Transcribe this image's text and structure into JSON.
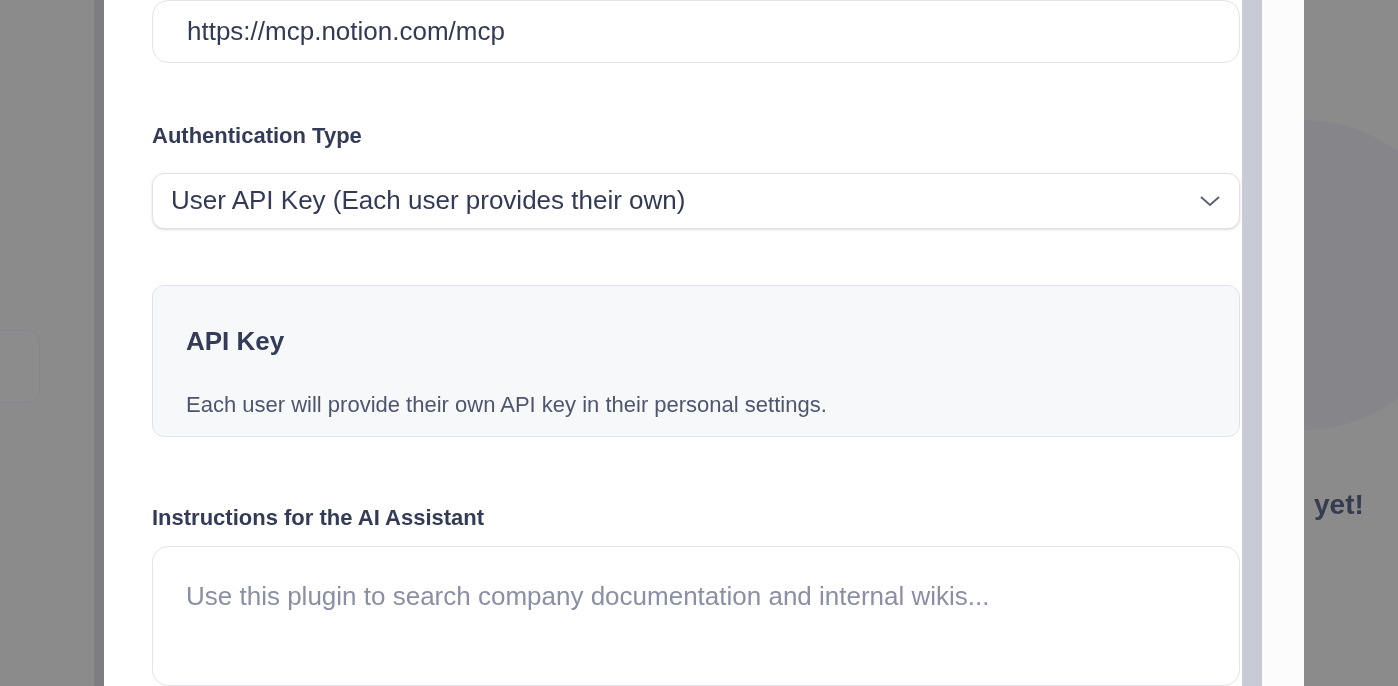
{
  "background": {
    "empty_state_text": "yet!"
  },
  "modal": {
    "server_url": {
      "value": "https://mcp.notion.com/mcp"
    },
    "authentication": {
      "label": "Authentication Type",
      "value": "User API Key (Each user provides their own)"
    },
    "api_key_panel": {
      "title": "API Key",
      "description": "Each user will provide their own API key in their personal settings."
    },
    "instructions": {
      "label": "Instructions for the AI Assistant",
      "placeholder": "Use this plugin to search company documentation and internal wikis..."
    }
  }
}
